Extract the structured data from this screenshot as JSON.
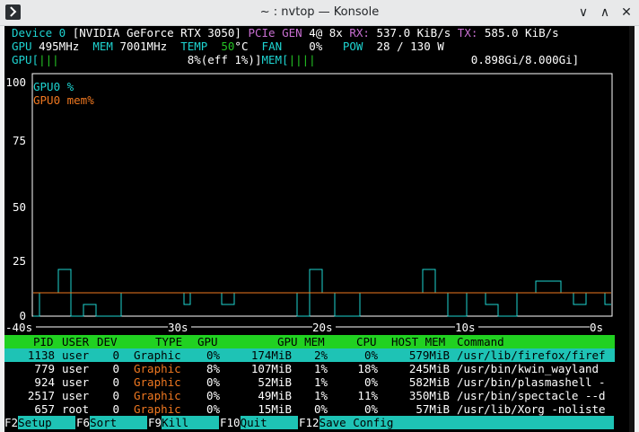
{
  "window": {
    "title": "~ : nvtop — Konsole"
  },
  "device": {
    "label": "Device 0",
    "name": "[NVIDIA GeForce RTX 3050]",
    "pcie_label": "PCIe",
    "gen_label": "GEN",
    "gen_value": "4@ 8x",
    "rx_label": "RX:",
    "rx_value": "537.0 KiB/s",
    "tx_label": "TX:",
    "tx_value": "585.0 KiB/s",
    "gpu_label": "GPU",
    "gpu_clock": "495MHz",
    "mem_label": "MEM",
    "mem_clock": "7001MHz",
    "temp_label": "TEMP",
    "temp_value": "50",
    "temp_unit": "°C",
    "fan_label": "FAN",
    "fan_value": "0%",
    "pow_label": "POW",
    "pow_value": "28 / 130 W",
    "gpu_bar_label": "GPU[",
    "gpu_bar_fill": "|||",
    "gpu_bar_text": "8%(eff 1%)]",
    "mem_bar_label": "MEM[",
    "mem_bar_fill": "||||",
    "mem_bar_text": "0.898Gi/8.000Gi]"
  },
  "chart_data": {
    "type": "line",
    "title": "",
    "ylim": [
      0,
      100
    ],
    "y_ticks": [
      "100",
      "75",
      "50",
      "25",
      "0"
    ],
    "x_ticks": [
      "-40s",
      "30s",
      "20s",
      "10s",
      "0s"
    ],
    "legend_placement": "top-left",
    "grid": false,
    "series": [
      {
        "name": "GPU0 %",
        "color": "#1ed4d1",
        "values": [
          0,
          10,
          10,
          10,
          20,
          20,
          0,
          0,
          5,
          5,
          0,
          0,
          0,
          0,
          10,
          10,
          10,
          10,
          10,
          10,
          10,
          10,
          10,
          10,
          5,
          10,
          10,
          10,
          10,
          10,
          5,
          5,
          10,
          10,
          10,
          10,
          10,
          10,
          10,
          10,
          10,
          10,
          0,
          0,
          20,
          20,
          10,
          10,
          0,
          0,
          0,
          0,
          10,
          10,
          10,
          10,
          10,
          10,
          10,
          10,
          10,
          10,
          20,
          20,
          10,
          10,
          0,
          0,
          0,
          10,
          10,
          10,
          5,
          5,
          0,
          0,
          0,
          10,
          10,
          10,
          15,
          15,
          15,
          15,
          10,
          10,
          5,
          5,
          10,
          10,
          10,
          5
        ]
      },
      {
        "name": "GPU0 mem%",
        "color": "#f07820",
        "values": [
          10,
          10,
          10,
          10,
          10,
          10,
          10,
          10,
          10,
          10,
          10,
          10,
          10,
          10,
          10,
          10,
          10,
          10,
          10,
          10,
          10,
          10,
          10,
          10,
          10,
          10,
          10,
          10,
          10,
          10,
          10,
          10,
          10,
          10,
          10,
          10,
          10,
          10,
          10,
          10,
          10,
          10,
          10,
          10,
          10,
          10,
          10,
          10,
          10,
          10,
          10,
          10,
          10,
          10,
          10,
          10,
          10,
          10,
          10,
          10,
          10,
          10,
          10,
          10,
          10,
          10,
          10,
          10,
          10,
          10,
          10,
          10,
          10,
          10,
          10,
          10,
          10,
          10,
          10,
          10,
          10,
          10,
          10,
          10,
          10,
          10,
          10,
          10,
          10,
          10,
          10,
          10
        ]
      }
    ]
  },
  "process_table": {
    "columns": [
      "PID",
      "USER",
      "DEV",
      "TYPE",
      "GPU",
      "GPU MEM",
      "CPU",
      "HOST MEM",
      "Command"
    ],
    "rows": [
      {
        "pid": "1138",
        "user": "user",
        "dev": "0",
        "type": "Graphic",
        "gpu": "0%",
        "gpu_mem": "174MiB",
        "gpu_mem_pct": "2%",
        "cpu": "0%",
        "host_mem": "579MiB",
        "command": "/usr/lib/firefox/firef"
      },
      {
        "pid": "779",
        "user": "user",
        "dev": "0",
        "type": "Graphic",
        "gpu": "8%",
        "gpu_mem": "107MiB",
        "gpu_mem_pct": "1%",
        "cpu": "18%",
        "host_mem": "245MiB",
        "command": "/usr/bin/kwin_wayland"
      },
      {
        "pid": "924",
        "user": "user",
        "dev": "0",
        "type": "Graphic",
        "gpu": "0%",
        "gpu_mem": "52MiB",
        "gpu_mem_pct": "1%",
        "cpu": "0%",
        "host_mem": "582MiB",
        "command": "/usr/bin/plasmashell -"
      },
      {
        "pid": "2517",
        "user": "user",
        "dev": "0",
        "type": "Graphic",
        "gpu": "0%",
        "gpu_mem": "49MiB",
        "gpu_mem_pct": "1%",
        "cpu": "11%",
        "host_mem": "350MiB",
        "command": "/usr/bin/spectacle --d"
      },
      {
        "pid": "657",
        "user": "root",
        "dev": "0",
        "type": "Graphic",
        "gpu": "0%",
        "gpu_mem": "15MiB",
        "gpu_mem_pct": "0%",
        "cpu": "0%",
        "host_mem": "57MiB",
        "command": "/usr/lib/Xorg -noliste"
      }
    ]
  },
  "function_keys": [
    {
      "key": "F2",
      "label": "Setup"
    },
    {
      "key": "F6",
      "label": "Sort"
    },
    {
      "key": "F9",
      "label": "Kill"
    },
    {
      "key": "F10",
      "label": "Quit"
    },
    {
      "key": "F12",
      "label": "Save Config"
    }
  ]
}
